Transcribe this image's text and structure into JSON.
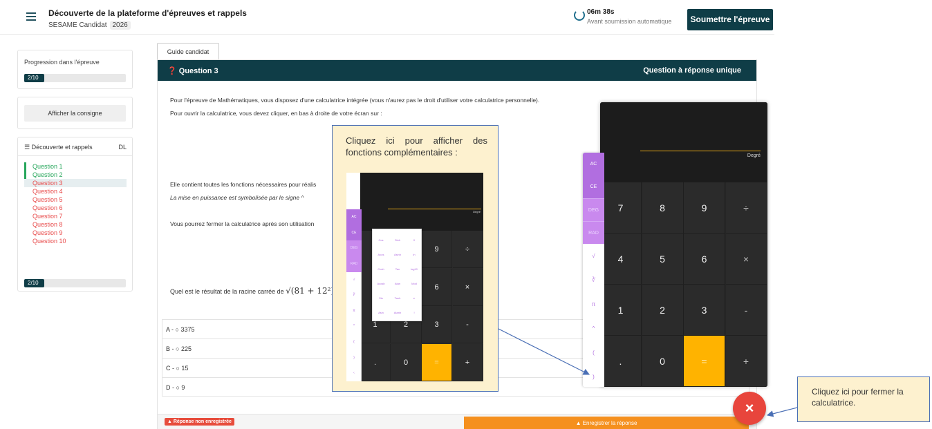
{
  "header": {
    "title": "Découverte de la plateforme d'épreuves et rappels",
    "subtitle": "SESAME Candidat",
    "year": "2026",
    "timer_value": "06m 38s",
    "timer_label": "Avant soumission automatique",
    "submit_label": "Soumettre l'épreuve"
  },
  "left": {
    "progress_label": "Progression dans l'épreuve",
    "progress_text": "2/10",
    "progress_fraction": 0.2,
    "consigne_label": "Afficher la consigne",
    "nav_title": "Découverte et rappels",
    "nav_badge": "DL",
    "questions": [
      "Question 1",
      "Question 2",
      "Question 3",
      "Question 4",
      "Question 5",
      "Question 6",
      "Question 7",
      "Question 8",
      "Question 9",
      "Question 10"
    ],
    "bottom_progress_text": "2/10"
  },
  "main": {
    "tab_label": "Guide candidat",
    "question_title": "Question 3",
    "question_type": "Question à réponse unique",
    "line1": "Pour l'épreuve de Mathématiques, vous disposez d'une calculatrice intégrée (vous n'aurez pas le droit d'utiliser votre calculatrice personnelle).",
    "line2": "Pour ouvrir la calculatrice, vous devez cliquer, en bas à droite de votre écran sur :",
    "line3": "Elle contient toutes les fonctions nécessaires pour réalis",
    "line4": "La mise en puissance est symbolisée par le signe ^",
    "line5": "Vous pourrez fermer la calculatrice après son utilisation",
    "question_text": "Quel est le résultat de la racine carrée de",
    "formula": "(81 + 12²)",
    "answers": [
      "A - ○ 3375",
      "B - ○ 225",
      "C - ○ 15",
      "D - ○ 9"
    ],
    "not_saved": "▲ Réponse non enregistrée",
    "save_label": "▲ Enregistrer la réponse"
  },
  "calculator": {
    "mode": "Degré",
    "side": [
      "AC",
      "CE",
      "DEG",
      "RAD",
      "√",
      "∛",
      "π",
      "^",
      "(",
      ")",
      "›"
    ],
    "keys": [
      "7",
      "8",
      "9",
      "÷",
      "4",
      "5",
      "6",
      "×",
      "1",
      "2",
      "3",
      "-",
      ".",
      "0",
      "=",
      "+"
    ],
    "close_label": "×"
  },
  "callout": {
    "text": "Cliquez ici pour afficher des fonctions complémentaires :",
    "mini_mode": "Degré",
    "mini_side": [
      "AC",
      "CE",
      "DEG",
      "RAD",
      "√",
      "∛",
      "π",
      "^",
      "(",
      ")",
      "‹"
    ],
    "mini_keys": [
      "9",
      "÷",
      "6",
      "×",
      "1",
      "2",
      "3",
      "-",
      ".",
      "0",
      "=",
      "+"
    ],
    "functions": [
      "Cos",
      "Sinh",
      "X",
      "Acos",
      "Asinh",
      "ln",
      "Cosh",
      "Tan",
      "log10",
      "Acosh",
      "Atan",
      "Mod",
      "Sin",
      "Tanh",
      "e",
      "Asin",
      "Atanh",
      "!"
    ]
  },
  "note": {
    "text": "Cliquez ici pour fermer la calculatrice."
  }
}
